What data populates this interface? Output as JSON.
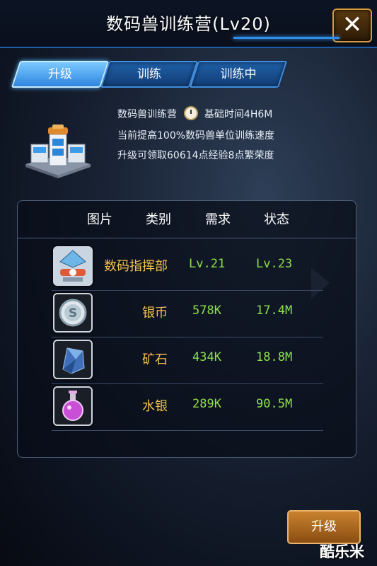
{
  "window": {
    "title": "数码兽训练营(Lv20)",
    "close_label": "✕"
  },
  "tabs": [
    {
      "label": "升级",
      "active": true
    },
    {
      "label": "训练",
      "active": false
    },
    {
      "label": "训练中",
      "active": false
    }
  ],
  "building": {
    "name": "数码兽训练营",
    "base_time_label": "基础时间4H6M",
    "effect": "当前提高100%数码兽单位训练速度",
    "reward": "升级可领取60614点经验8点繁荣度"
  },
  "table": {
    "headers": [
      "图片",
      "类别",
      "需求",
      "状态"
    ],
    "rows": [
      {
        "icon": "command-center-icon",
        "category": "数码指挥部",
        "requirement": "Lv.21",
        "status": "Lv.23"
      },
      {
        "icon": "silver-coin-icon",
        "category": "银币",
        "requirement": "578K",
        "status": "17.4M"
      },
      {
        "icon": "ore-crystal-icon",
        "category": "矿石",
        "requirement": "434K",
        "status": "18.8M"
      },
      {
        "icon": "mercury-potion-icon",
        "category": "水银",
        "requirement": "289K",
        "status": "90.5M"
      }
    ]
  },
  "upgrade_button": "升级",
  "watermark": "酷乐米",
  "colors": {
    "category_text": "#f2c14e",
    "value_text": "#8ee04a",
    "tab_blue": "#2f86e0",
    "button_orange": "#c9822e"
  }
}
